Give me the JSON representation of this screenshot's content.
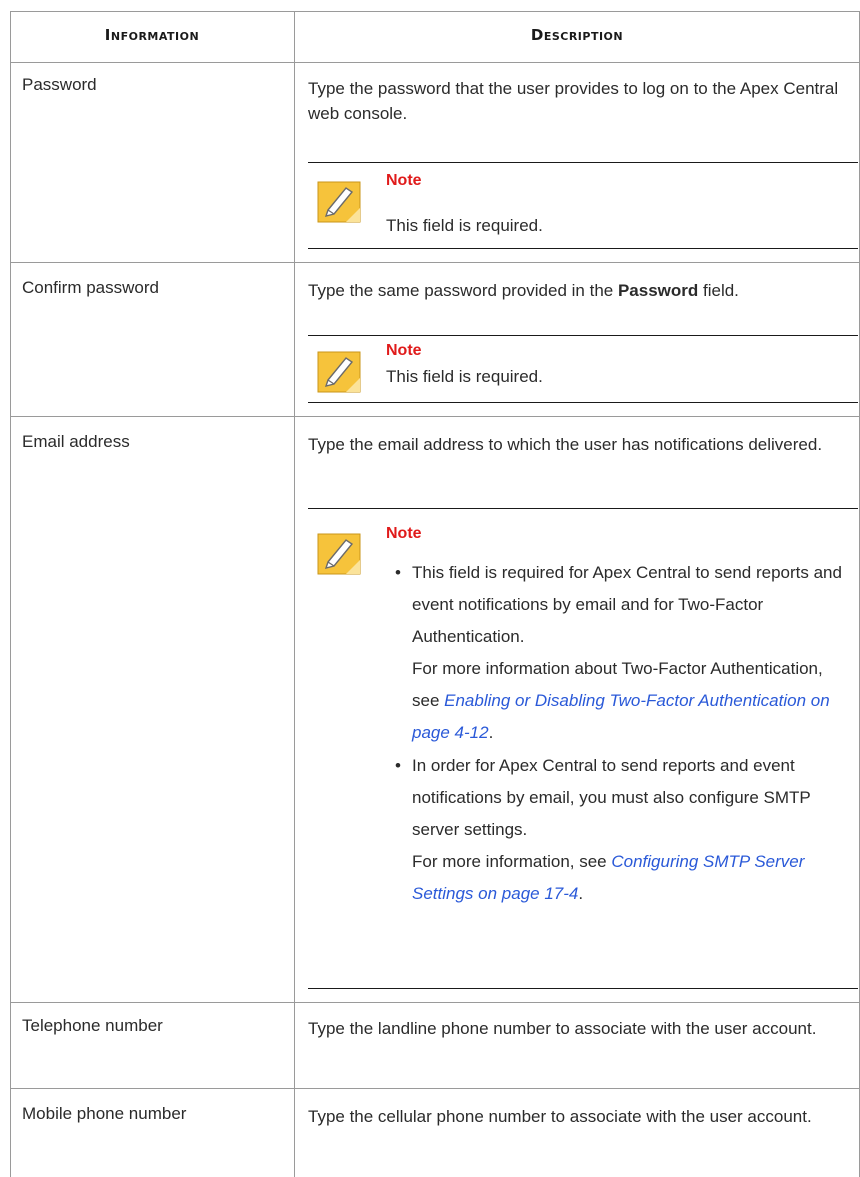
{
  "table": {
    "headers": {
      "information": "Information",
      "description": "Description"
    },
    "rows": [
      {
        "label": "Password",
        "desc": "Type the password that the user provides to log on to the Apex Central web console.",
        "note_title": "Note",
        "note_text": "This field is required."
      },
      {
        "label": "Confirm password",
        "desc_pre": "Type the same password provided in the ",
        "desc_bold": "Password",
        "desc_post": " field.",
        "note_title": "Note",
        "note_text": "This field is required."
      },
      {
        "label": "Email address",
        "desc": "Type the email address to which the user has notifications delivered.",
        "note_title": "Note",
        "bullets": [
          {
            "text": "This field is required for Apex Central to send reports and event notifications by email and for Two-Factor Authentication.",
            "more_pre": "For more information about Two-Factor Authentication, see ",
            "more_link": "Enabling or Disabling Two-Factor Authentication on page 4-12",
            "more_post": "."
          },
          {
            "text": "In order for Apex Central to send reports and event notifications by email, you must also configure SMTP server settings.",
            "more_pre": "For more information, see ",
            "more_link": "Configuring SMTP Server Settings on page 17-4",
            "more_post": "."
          }
        ]
      },
      {
        "label": "Telephone number",
        "desc": "Type the landline phone number to associate with the user account."
      },
      {
        "label": "Mobile phone number",
        "desc": "Type the cellular phone number to associate with the user account."
      }
    ]
  },
  "colors": {
    "note_title": "#e01b1b",
    "link": "#2a59d8",
    "icon_fill": "#f6c33b"
  }
}
